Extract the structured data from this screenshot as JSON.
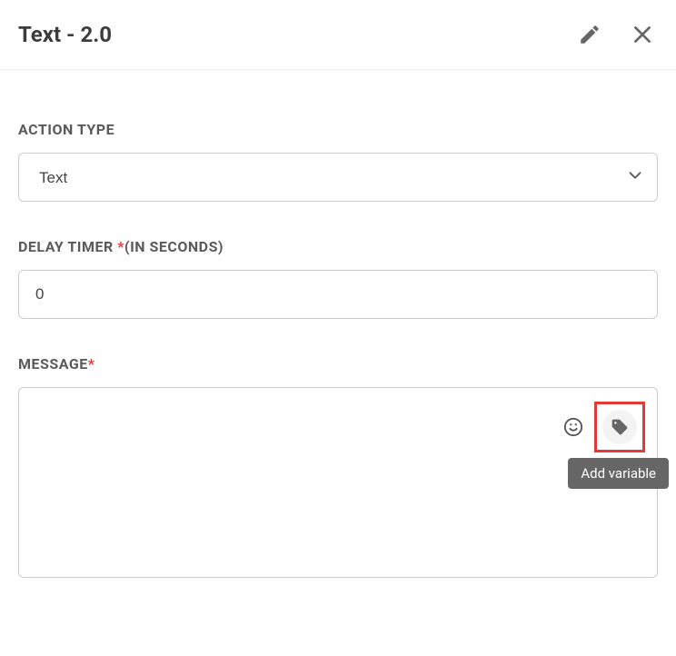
{
  "header": {
    "title": "Text - 2.0"
  },
  "actionType": {
    "label": "ACTION TYPE",
    "value": "Text"
  },
  "delayTimer": {
    "label": "DELAY TIMER ",
    "hint": "(IN SECONDS)",
    "value": "0"
  },
  "message": {
    "label": "MESSAGE",
    "value": ""
  },
  "tooltip": {
    "addVariable": "Add variable"
  }
}
